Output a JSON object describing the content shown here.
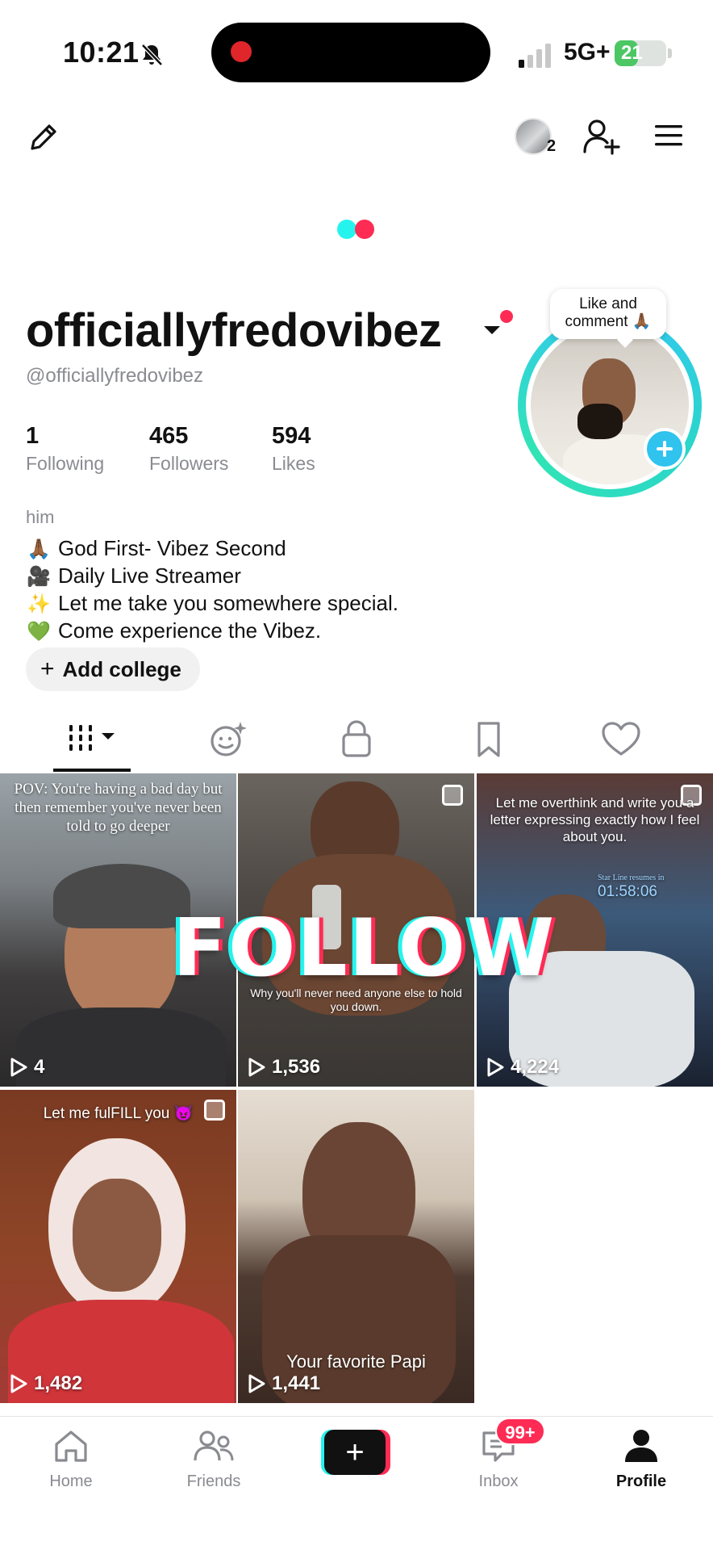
{
  "status_bar": {
    "time": "10:21",
    "network": "5G+",
    "battery": "21",
    "battery_level": 0.21,
    "icons": [
      "bell-slash-icon",
      "signal-icon",
      "battery-charging-icon"
    ]
  },
  "profile": {
    "display_name": "officiallyfredovibez",
    "handle": "@officiallyfredovibez",
    "avatar_count": "2",
    "story_bubble": "Like and comment 🙏🏾",
    "stats": [
      {
        "value": "1",
        "label": "Following"
      },
      {
        "value": "465",
        "label": "Followers"
      },
      {
        "value": "594",
        "label": "Likes"
      }
    ],
    "pronouns": "him",
    "bio": [
      {
        "emoji": "🙏🏾",
        "text": "God First- Vibez Second"
      },
      {
        "emoji": "🎥",
        "text": "Daily Live Streamer"
      },
      {
        "emoji": "✨",
        "text": "Let me take you somewhere special."
      },
      {
        "emoji": "💚",
        "text": "Come experience the Vibez."
      }
    ],
    "add_college": "Add college"
  },
  "tabs": [
    "videos-grid-icon",
    "reposts-icon",
    "private-lock-icon",
    "favorites-bookmark-icon",
    "liked-heart-icon"
  ],
  "overlay_text": "FOLLOW",
  "videos": [
    {
      "caption": "POV: You're having a bad day but then remember you've never been told to go deeper",
      "views": "4"
    },
    {
      "caption": "Why you'll never need anyone else to hold you down.",
      "views": "1,536"
    },
    {
      "caption": "Let me overthink and write you a letter expressing exactly how I feel about you.",
      "views": "4,224",
      "subcaption": "Star Line resumes in",
      "timer": "01:58:06"
    },
    {
      "caption": "Let me fulFILL you 😈",
      "views": "1,482"
    },
    {
      "caption": "Your favorite Papi",
      "views": "1,441"
    }
  ],
  "bottom_nav": {
    "home": "Home",
    "friends": "Friends",
    "inbox": "Inbox",
    "inbox_badge": "99+",
    "profile": "Profile"
  },
  "colors": {
    "accent_pink": "#fe2c55",
    "accent_cyan": "#25f4ee",
    "story_ring": "#31c7f4"
  }
}
